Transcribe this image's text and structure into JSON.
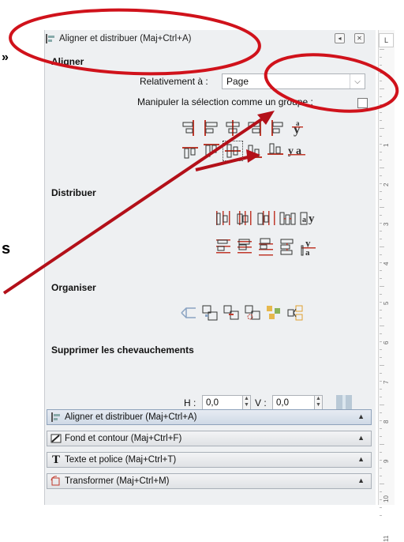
{
  "panel": {
    "title": "Aligner et distribuer (Maj+Ctrl+A)",
    "title_icon": "align-distribute-icon",
    "buttons": [
      "detach-icon",
      "close-icon"
    ]
  },
  "align": {
    "section_label": "Aligner",
    "relative_label": "Relativement à :",
    "relative_value": "Page",
    "group_label": "Manipuler la sélection comme un groupe :",
    "group_checked": false
  },
  "distribute": {
    "section_label": "Distribuer"
  },
  "organize": {
    "section_label": "Organiser"
  },
  "overlap": {
    "section_label": "Supprimer les chevauchements",
    "h_label": "H :",
    "h_value": "0,0",
    "v_label": "V :",
    "v_value": "0,0"
  },
  "dock_tabs": [
    {
      "label": "Aligner et distribuer (Maj+Ctrl+A)",
      "icon": "align-distribute-icon",
      "active": true
    },
    {
      "label": "Fond et contour (Maj+Ctrl+F)",
      "icon": "fill-stroke-icon",
      "active": false
    },
    {
      "label": "Texte et police (Maj+Ctrl+T)",
      "icon": "text-font-icon",
      "active": false
    },
    {
      "label": "Transformer (Maj+Ctrl+M)",
      "icon": "transform-icon",
      "active": false
    }
  ],
  "ruler": {
    "corner_label": "L",
    "numbers": [
      "1",
      "2",
      "3",
      "4",
      "5",
      "6",
      "7",
      "8",
      "9",
      "10",
      "11"
    ]
  },
  "fragments": [
    "»",
    "s"
  ],
  "colors": {
    "annotation": "#d0121b",
    "icon_red": "#c0392b",
    "panel_bg": "#eef0f2",
    "active_tab": "#cfd9e6"
  }
}
